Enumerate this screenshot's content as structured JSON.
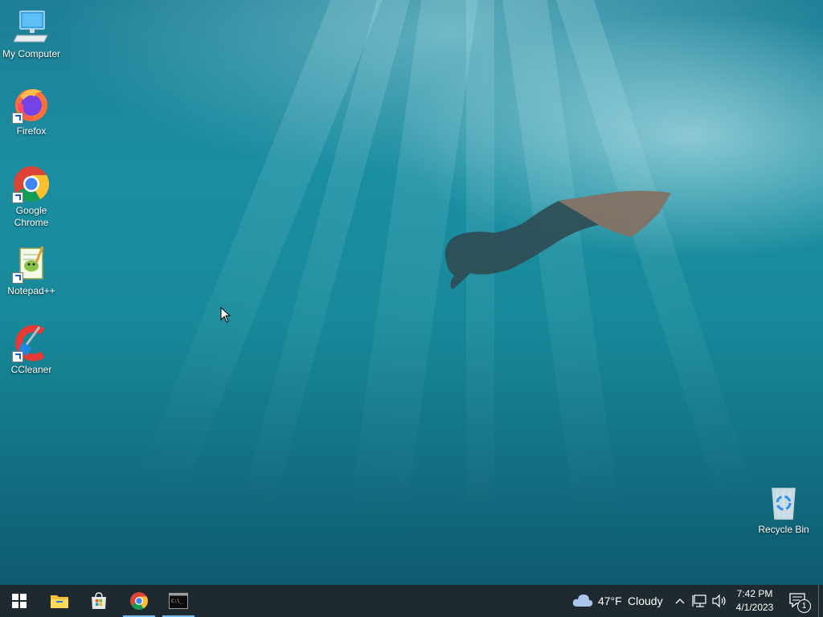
{
  "desktop": {
    "icons": [
      {
        "label": "My Computer",
        "icon": "computer-icon"
      },
      {
        "label": "Firefox",
        "icon": "firefox-icon"
      },
      {
        "label": "Google Chrome",
        "icon": "chrome-icon"
      },
      {
        "label": "Notepad++",
        "icon": "notepadpp-icon"
      },
      {
        "label": "CCleaner",
        "icon": "ccleaner-icon"
      },
      {
        "label": "Recycle Bin",
        "icon": "recycle-bin-icon"
      }
    ]
  },
  "taskbar": {
    "pinned": [
      {
        "icon": "windows-start-icon"
      },
      {
        "icon": "file-explorer-icon"
      },
      {
        "icon": "microsoft-store-icon"
      },
      {
        "icon": "chrome-icon",
        "active": true
      },
      {
        "icon": "terminal-icon",
        "active": true
      }
    ],
    "weather": {
      "temperature": "47°F",
      "condition": "Cloudy"
    },
    "clock": {
      "time": "7:42 PM",
      "date": "4/1/2023"
    },
    "notification_count": "1"
  },
  "colors": {
    "taskbar_bg": "#1f2a30",
    "active_indicator": "#76b9ed",
    "water": "#1a8ea1"
  }
}
